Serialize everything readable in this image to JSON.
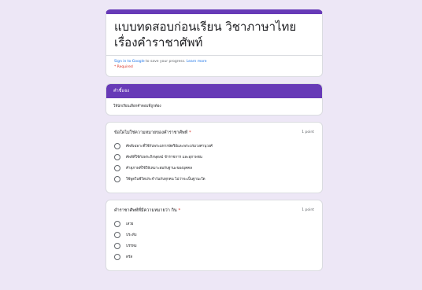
{
  "form": {
    "title": "แบบทดสอบก่อนเรียน วิชาภาษาไทย เรื่องคำราชาศัพท์",
    "signin_link": "Sign in to Google",
    "signin_rest": "to save your progress.",
    "learn_more": "Learn more",
    "required_note": "* Required"
  },
  "section": {
    "header": "คำชี้แจง",
    "description": "ให้นักเรียนเลือกคำตอบที่ถูกต้อง"
  },
  "questions": [
    {
      "text": "ข้อใดไม่ใช่ความหมายของคำราชาศัพท์",
      "required_mark": "*",
      "points": "1 point",
      "options": [
        "ศัพท์เฉพาะที่ใช้กับพระมหากษัตริย์และพระบรมวงศานุวงศ์",
        "ศัพท์ที่ใช้กับพระภิกษุสงฆ์ ข้าราชการ และสุภาพชน",
        "คำสุภาพที่ใช้ให้เหมาะสมกับฐานะของบุคคล",
        "ใช้พูดในชีวิตประจำวันกับทุกคน ไม่ว่าจะเป็นฐานะใด"
      ]
    },
    {
      "text": "คำราชาศัพท์ที่มีความหมายว่า กิน",
      "required_mark": "*",
      "points": "1 point",
      "options": [
        "เสวย",
        "ประทับ",
        "บรรทม",
        "ตรัส"
      ]
    }
  ]
}
